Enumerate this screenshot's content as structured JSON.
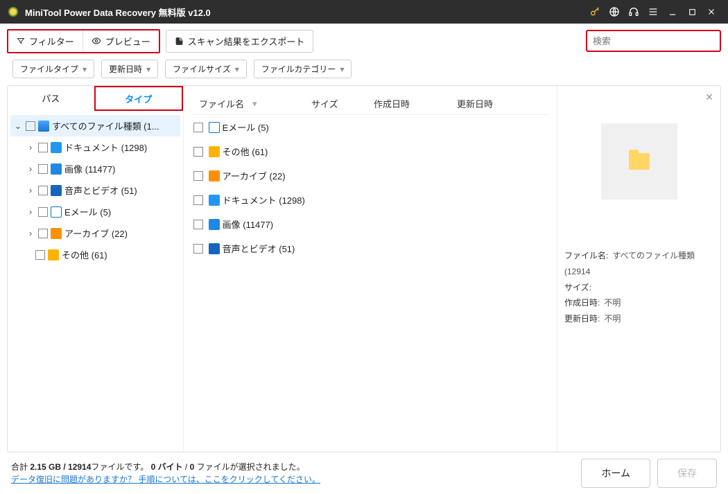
{
  "titlebar": {
    "title": "MiniTool Power Data Recovery 無料版 v12.0"
  },
  "toolbar": {
    "filter": "フィルター",
    "preview": "プレビュー",
    "export": "スキャン結果をエクスポート",
    "search_placeholder": "検索"
  },
  "chips": {
    "filetype": "ファイルタイプ",
    "date": "更新日時",
    "size": "ファイルサイズ",
    "category": "ファイルカテゴリー"
  },
  "tabs": {
    "path": "パス",
    "type": "タイプ"
  },
  "tree": {
    "root": "すべてのファイル種類 (1...",
    "doc": "ドキュメント (1298)",
    "img": "画像 (11477)",
    "av": "音声とビデオ (51)",
    "mail": "Eメール (5)",
    "arc": "アーカイブ (22)",
    "other": "その他 (61)"
  },
  "columns": {
    "name": "ファイル名",
    "size": "サイズ",
    "created": "作成日時",
    "updated": "更新日時"
  },
  "rows": {
    "mail": "Eメール (5)",
    "other": "その他 (61)",
    "arc": "アーカイブ (22)",
    "doc": "ドキュメント (1298)",
    "img": "画像 (11477)",
    "av": "音声とビデオ (51)"
  },
  "preview": {
    "filename_label": "ファイル名:",
    "filename_value": "すべてのファイル種類 (12914",
    "size_label": "サイズ:",
    "created_label": "作成日時:",
    "created_value": "不明",
    "updated_label": "更新日時:",
    "updated_value": "不明"
  },
  "footer": {
    "stats_pre": "合計 ",
    "stats_bold1": "2.15 GB / 12914",
    "stats_mid1": "ファイルです。",
    "stats_bold2": "0 バイト",
    "stats_mid2": " / ",
    "stats_bold3": "0",
    "stats_mid3": " ファイルが選択されました。",
    "help": "データ復旧に問題がありますか？ 手順については、ここをクリックしてください。",
    "home": "ホーム",
    "save": "保存"
  }
}
